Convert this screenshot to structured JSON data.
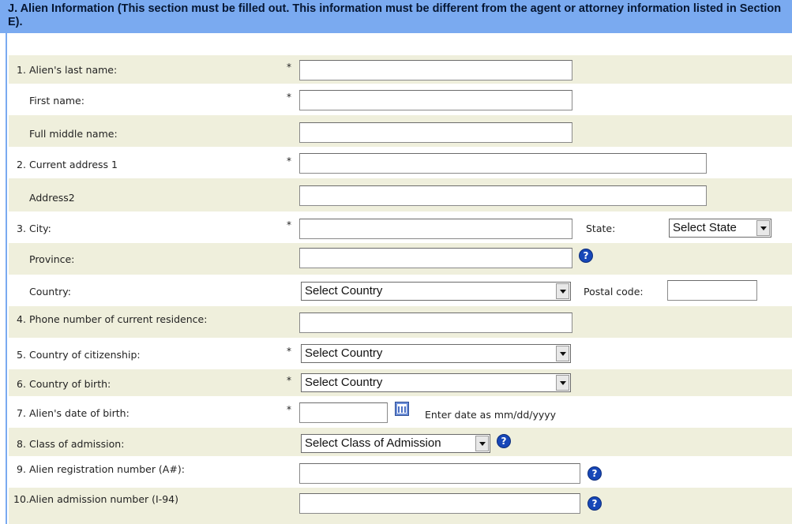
{
  "section": {
    "title": "J. Alien Information (This section must be filled out. This information must be different from the agent or attorney information listed in Section E).",
    "required_mark": "*"
  },
  "fields": {
    "last_name": {
      "num": "1.",
      "label": "Alien's last name:",
      "value": ""
    },
    "first_name": {
      "label": "First name:",
      "value": ""
    },
    "middle_name": {
      "label": "Full middle name:",
      "value": ""
    },
    "address1": {
      "num": "2.",
      "label": "Current address 1",
      "value": ""
    },
    "address2": {
      "label": "Address2",
      "value": ""
    },
    "city": {
      "num": "3.",
      "label": "City:",
      "value": ""
    },
    "state": {
      "label": "State:",
      "selected": "Select State"
    },
    "province": {
      "label": "Province:",
      "value": ""
    },
    "country": {
      "label": "Country:",
      "selected": "Select Country"
    },
    "postal_code": {
      "label": "Postal code:",
      "value": ""
    },
    "phone": {
      "num": "4.",
      "label": "Phone number of current residence:",
      "value": ""
    },
    "citizenship": {
      "num": "5.",
      "label": "Country of citizenship:",
      "selected": "Select Country"
    },
    "birth_country": {
      "num": "6.",
      "label": "Country of birth:",
      "selected": "Select Country"
    },
    "dob": {
      "num": "7.",
      "label": "Alien's date of birth:",
      "value": "",
      "hint": "Enter date as mm/dd/yyyy"
    },
    "class_admission": {
      "num": "8.",
      "label": "Class of admission:",
      "selected": "Select Class of Admission"
    },
    "registration": {
      "num": "9.",
      "label": "Alien registration number (A#):",
      "value": ""
    },
    "admission_number": {
      "num": "10.",
      "label": "Alien admission number (I-94)",
      "value": ""
    }
  },
  "icons": {
    "help": "help-icon",
    "calendar": "calendar-icon",
    "help_glyph": "?"
  },
  "colors": {
    "header_bg": "#7aaaf0",
    "row_shade": "#efefdc",
    "help_blue": "#1747b8"
  }
}
